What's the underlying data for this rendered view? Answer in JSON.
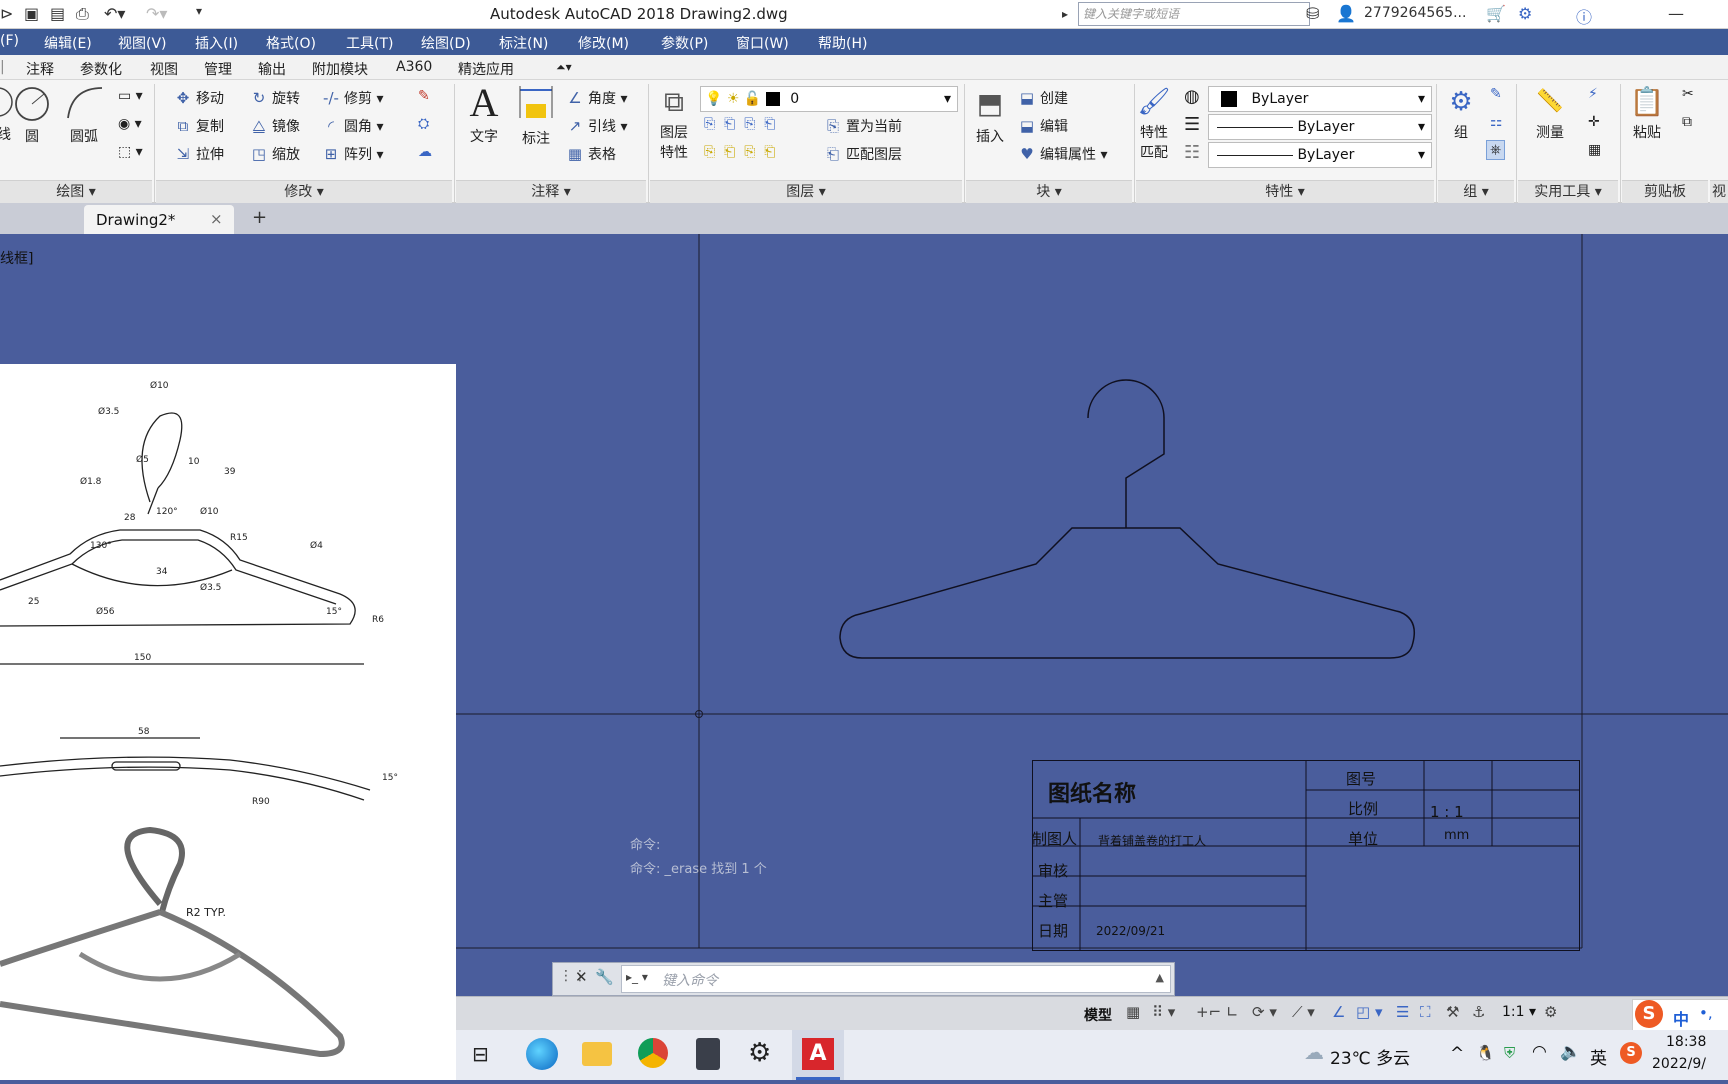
{
  "app": {
    "title": "Autodesk AutoCAD 2018    Drawing2.dwg",
    "search_placeholder": "键入关键字或短语",
    "user": "2779264565..."
  },
  "menu": [
    "(F)",
    "编辑(E)",
    "视图(V)",
    "插入(I)",
    "格式(O)",
    "工具(T)",
    "绘图(D)",
    "标注(N)",
    "修改(M)",
    "参数(P)",
    "窗口(W)",
    "帮助(H)"
  ],
  "ribbon_tabs": [
    "注释",
    "参数化",
    "视图",
    "管理",
    "输出",
    "附加模块",
    "A360",
    "精选应用"
  ],
  "ribbon": {
    "draw": {
      "panel": "绘图",
      "circle": "圆",
      "arc": "圆弧",
      "edge": "线"
    },
    "modify": {
      "panel": "修改",
      "move": "移动",
      "rotate": "旋转",
      "trim": "修剪",
      "copy": "复制",
      "mirror": "镜像",
      "fillet": "圆角",
      "stretch": "拉伸",
      "scale": "缩放",
      "array": "阵列"
    },
    "annotation": {
      "panel": "注释",
      "text": "文字",
      "dimension": "标注",
      "angle": "角度",
      "leader": "引线",
      "table": "表格"
    },
    "layers": {
      "panel": "图层",
      "layer_props_1": "图层",
      "layer_props_2": "特性",
      "current_layer": "0",
      "set_current": "置为当前",
      "match_layer": "匹配图层"
    },
    "block": {
      "panel": "块",
      "insert": "插入",
      "create": "创建",
      "edit": "编辑",
      "edit_attr": "编辑属性"
    },
    "properties": {
      "panel": "特性",
      "match_1": "特性",
      "match_2": "匹配",
      "color": "ByLayer",
      "linetype": "ByLayer",
      "lineweight": "ByLayer"
    },
    "groups": {
      "panel": "组",
      "group": "组"
    },
    "utilities": {
      "panel": "实用工具",
      "measure": "测量"
    },
    "clipboard": {
      "panel": "剪贴板",
      "paste": "粘贴"
    },
    "view_panel": "视"
  },
  "doc_tab": {
    "label": "Drawing2*",
    "close": "×",
    "add": "+"
  },
  "viewport_label": "线框]",
  "title_block": {
    "drawing_name": "图纸名称",
    "fig_no_label": "图号",
    "scale_label": "比例",
    "scale_value": "1 : 1",
    "unit_label": "单位",
    "unit_value": "mm",
    "drafter_label": "制图人",
    "drafter_value": "背着铺盖卷的打工人",
    "review_label": "审核",
    "supervisor_label": "主管",
    "date_label": "日期",
    "date_value": "2022/09/21"
  },
  "reference": {
    "dims": [
      "Ø3.5",
      "Ø10",
      "Ø1.8",
      "Ø5",
      "10",
      "39",
      "28",
      "120°",
      "Ø10",
      "130°",
      "R15",
      "Ø4",
      "34",
      "25",
      "Ø56",
      "Ø3.5",
      "15°",
      "R6",
      "150",
      "58",
      "15°",
      "R90"
    ],
    "note": "R2  TYP."
  },
  "command": {
    "history_1": "命令:",
    "history_2": "命令: _erase 找到 1 个",
    "placeholder": "键入命令"
  },
  "status": {
    "model": "模型",
    "scale": "1:1"
  },
  "taskbar": {
    "weather": "23℃ 多云",
    "ime": "英",
    "time": "18:38",
    "date": "2022/9/",
    "ime_cn": "中"
  }
}
